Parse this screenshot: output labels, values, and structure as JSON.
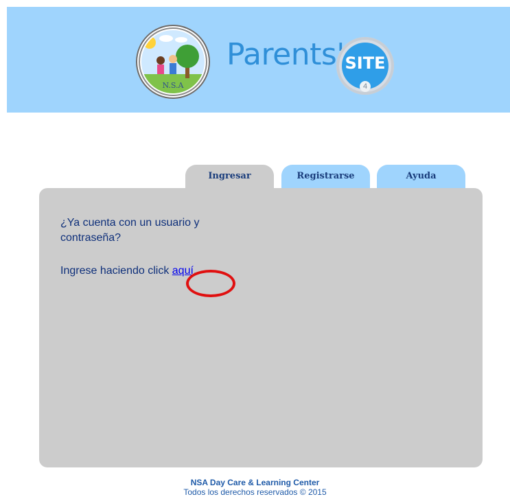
{
  "header": {
    "logo_text": "N.S.A",
    "brand_text": "Parents'",
    "site_badge_text": "SITE",
    "site_badge_number": "4"
  },
  "tabs": [
    {
      "label": "Ingresar",
      "active": true
    },
    {
      "label": "Registrarse",
      "active": false
    },
    {
      "label": "Ayuda",
      "active": false
    }
  ],
  "panel": {
    "question": "¿Ya cuenta con un usuario y contraseña?",
    "login_prefix": "Ingrese haciendo click",
    "login_link": "aquí",
    "login_suffix": "."
  },
  "footer": {
    "organization": "NSA Day Care & Learning Center",
    "copyright": "Todos los derechos reservados © 2015"
  },
  "colors": {
    "header_bg": "#9fd4fd",
    "panel_bg": "#cccccc",
    "text_navy": "#0e2f7a",
    "link": "#0000ee",
    "annotation": "#e01010"
  }
}
